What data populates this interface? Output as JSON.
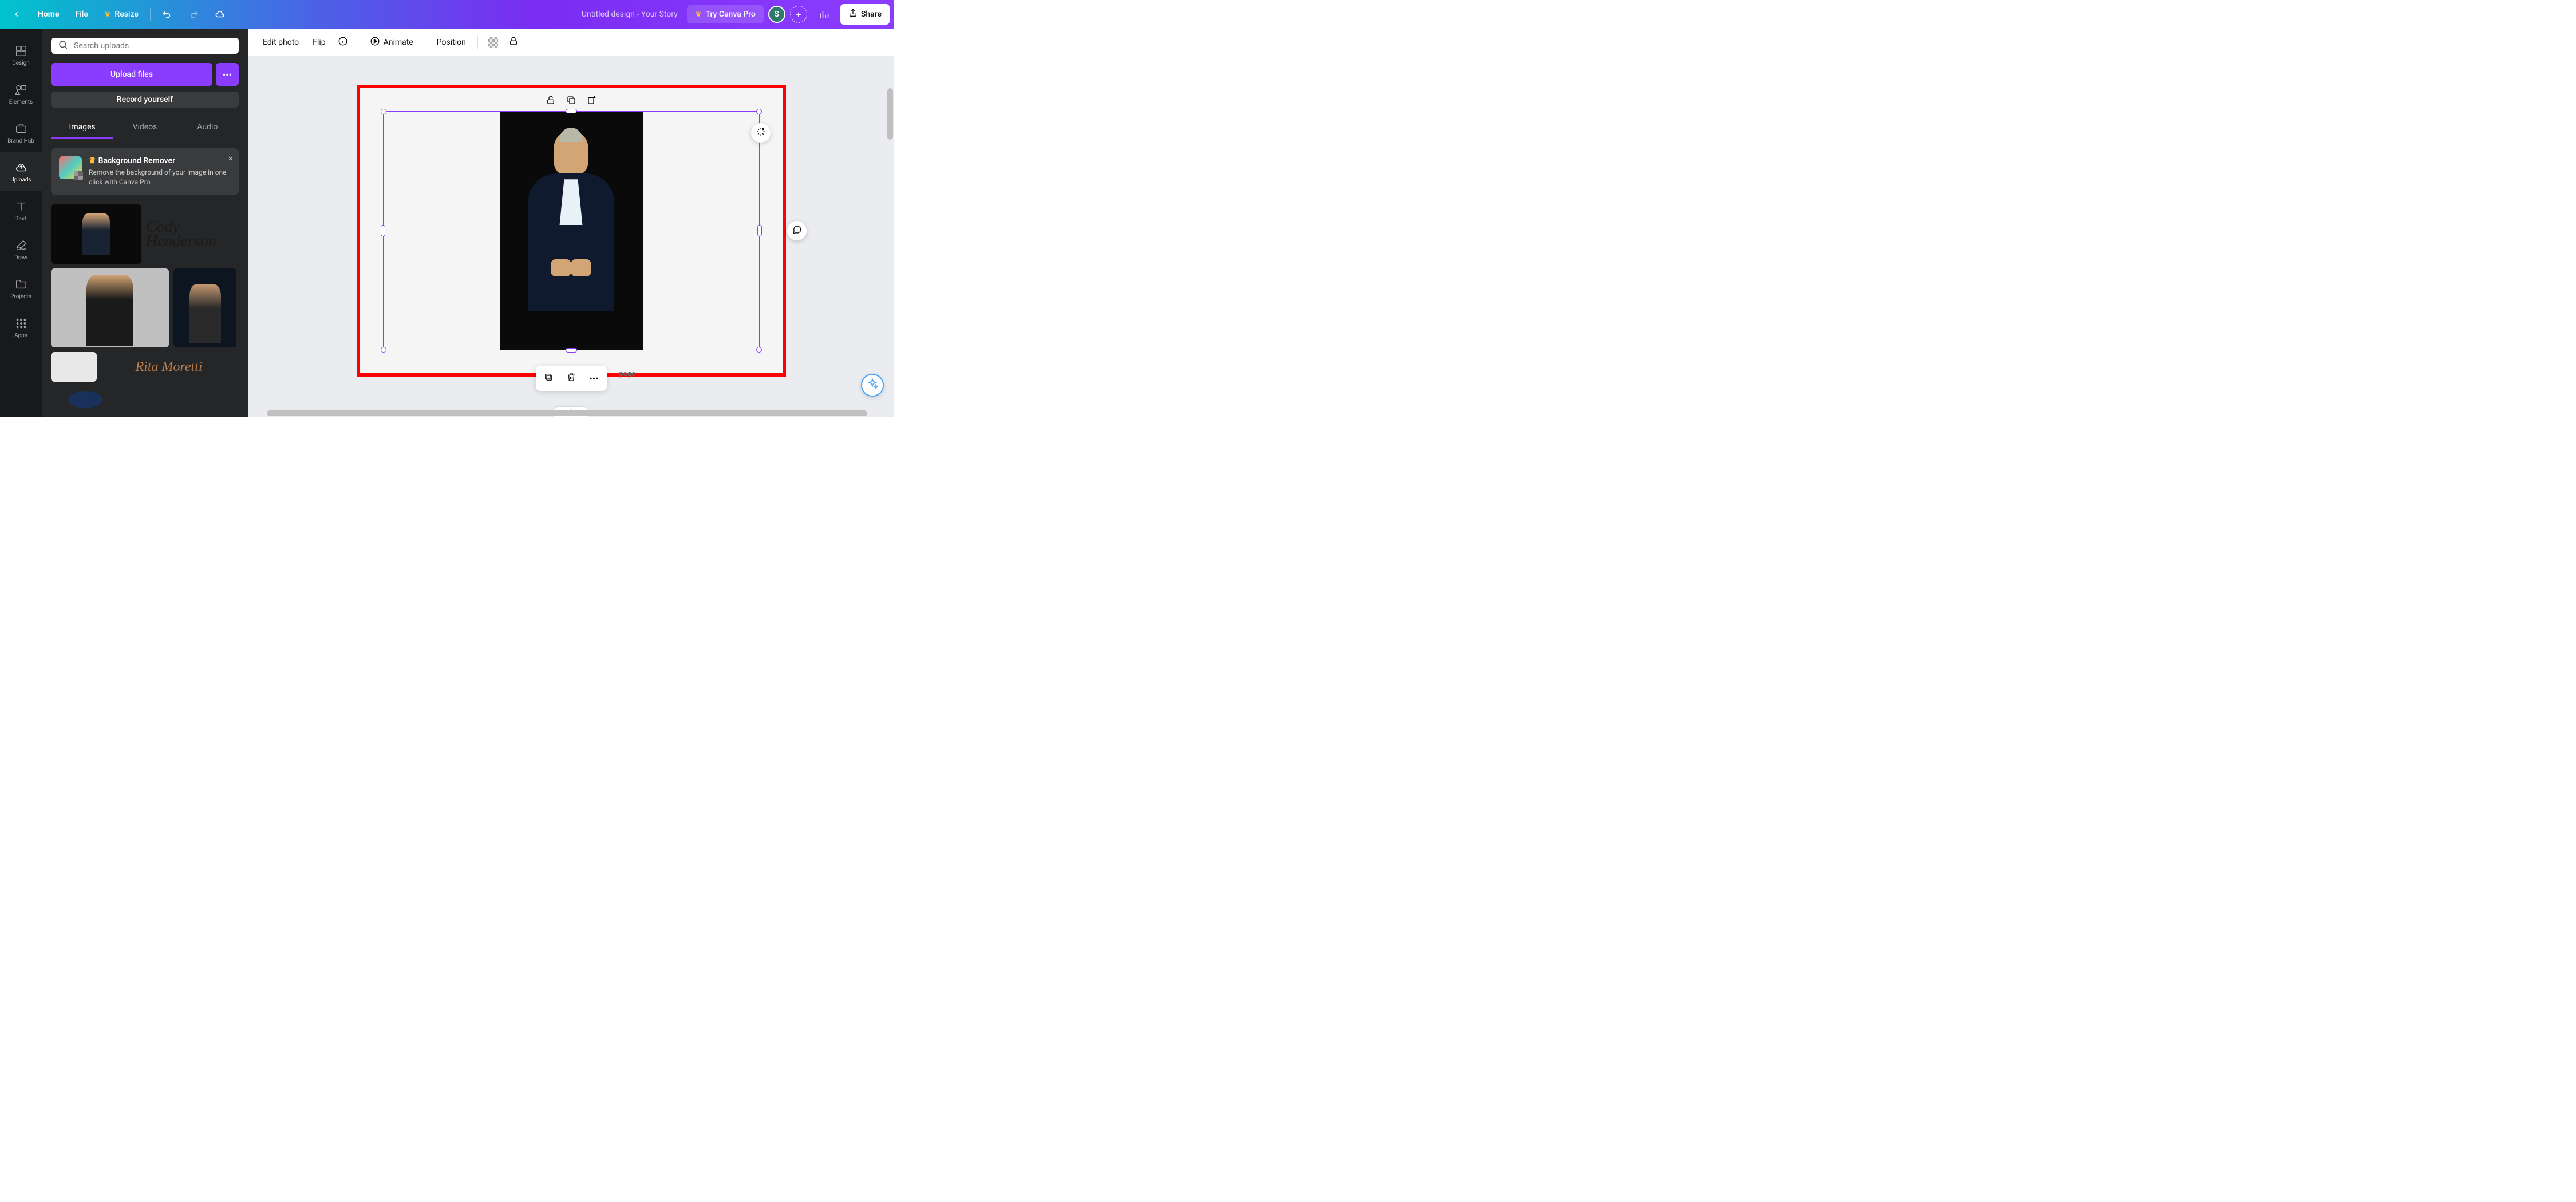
{
  "topbar": {
    "home": "Home",
    "file": "File",
    "resize": "Resize",
    "docTitle": "Untitled design - Your Story",
    "tryPro": "Try Canva Pro",
    "share": "Share",
    "avatarInitial": "S"
  },
  "nav": {
    "design": "Design",
    "elements": "Elements",
    "brandHub": "Brand Hub",
    "uploads": "Uploads",
    "text": "Text",
    "draw": "Draw",
    "projects": "Projects",
    "apps": "Apps"
  },
  "panel": {
    "searchPlaceholder": "Search uploads",
    "uploadFiles": "Upload files",
    "recordYourself": "Record yourself",
    "tabs": {
      "images": "Images",
      "videos": "Videos",
      "audio": "Audio"
    },
    "promo": {
      "title": "Background Remover",
      "desc": "Remove the background of your image in one click with Canva Pro."
    },
    "thumbSignature1": "Cody Henderson",
    "thumbSignature2": "Rita Moretti"
  },
  "context": {
    "editPhoto": "Edit photo",
    "flip": "Flip",
    "animate": "Animate",
    "position": "Position"
  },
  "canvas": {
    "addPage": "page"
  }
}
